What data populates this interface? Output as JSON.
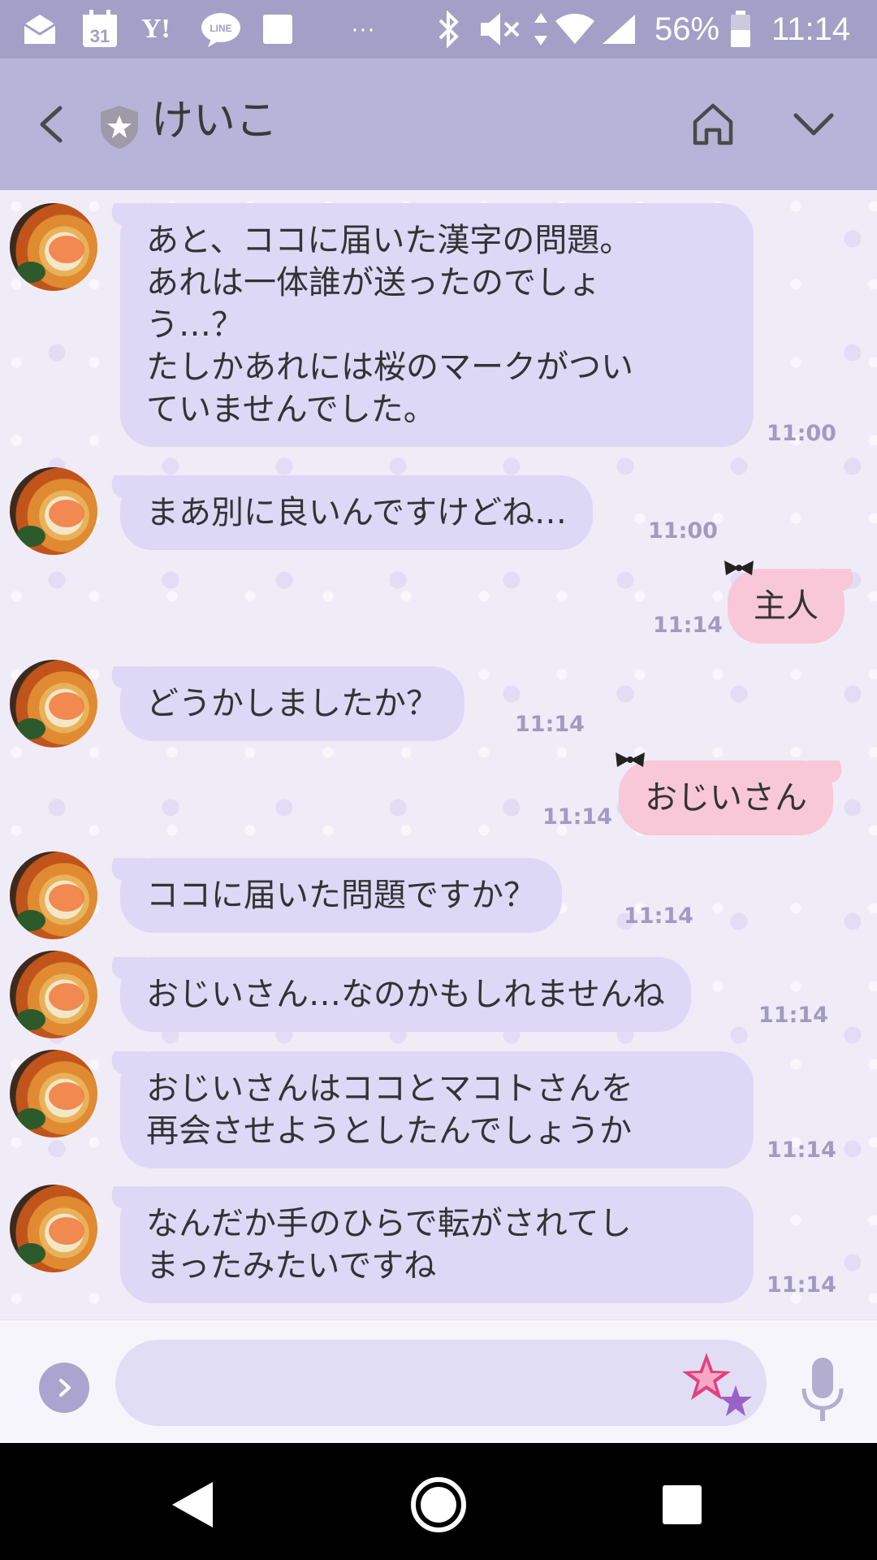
{
  "status_bar": {
    "battery": "56%",
    "time": "11:14",
    "calendar_day": "31",
    "yahoo_label": "Y!",
    "line_label": "LINE",
    "more": "···"
  },
  "header": {
    "title": "けいこ"
  },
  "messages": [
    {
      "side": "in",
      "text": "あと、ココに届いた漢字の問題。\nあれは一体誰が送ったのでしょ\nう…？\nたしかあれには桜のマークがつい\nていませんでした。",
      "time": "11:00"
    },
    {
      "side": "in",
      "text": "まあ別に良いんですけどね…",
      "time": "11:00"
    },
    {
      "side": "out",
      "text": "主人",
      "time": "11:14"
    },
    {
      "side": "in",
      "text": "どうかしましたか？",
      "time": "11:14"
    },
    {
      "side": "out",
      "text": "おじいさん",
      "time": "11:14"
    },
    {
      "side": "in",
      "text": "ココに届いた問題ですか？",
      "time": "11:14"
    },
    {
      "side": "in",
      "text": "おじいさん…なのかもしれませんね",
      "time": "11:14"
    },
    {
      "side": "in",
      "text": "おじいさんはココとマコトさんを\n再会させようとしたんでしょうか",
      "time": "11:14"
    },
    {
      "side": "in",
      "text": "なんだか手のひらで転がされてし\nまったみたいですね",
      "time": "11:14"
    }
  ],
  "input": {
    "placeholder": ""
  },
  "colors": {
    "header_bg": "#b8b3d8",
    "status_bg": "#a49fc6",
    "bubble_in": "#dcd8f6",
    "bubble_out": "#f8c7d8",
    "time_text": "#a09bc0"
  },
  "icons": [
    "back-icon",
    "shield-star-icon",
    "home-icon",
    "chevron-down-icon",
    "more-arrow-icon",
    "sticker-icon",
    "mic-icon",
    "nav-back-icon",
    "nav-home-icon",
    "nav-recents-icon"
  ]
}
